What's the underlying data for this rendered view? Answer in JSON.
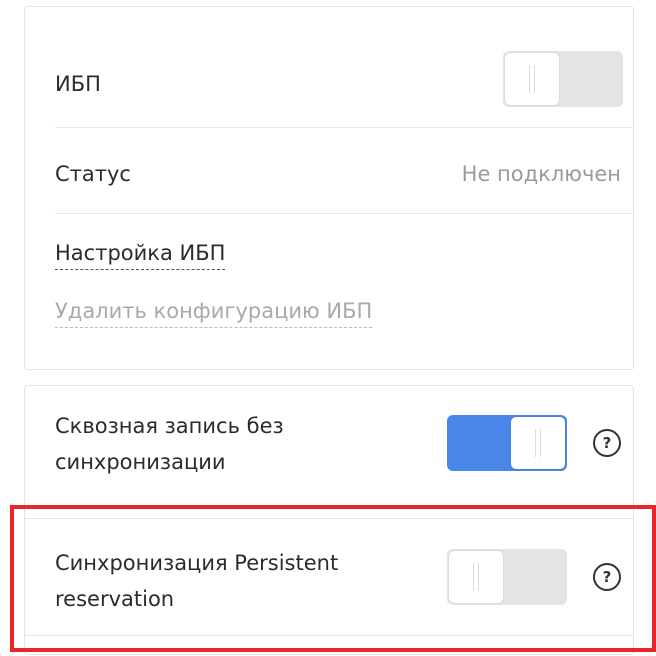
{
  "ups": {
    "title": "ИБП",
    "toggle_state": "off",
    "status_label": "Статус",
    "status_value": "Не подключен",
    "settings_link": "Настройка ИБП",
    "delete_link": "Удалить конфигурацию ИБП"
  },
  "options": {
    "writethrough_label": "Сквозная запись без синхронизации",
    "writethrough_state": "on",
    "persistent_label": "Синхронизация Persistent reservation",
    "persistent_state": "off",
    "help_glyph": "?"
  },
  "icons": {
    "help": "question-circle-icon"
  },
  "colors": {
    "accent": "#4a86e8",
    "highlight": "#e8262c",
    "muted": "#9a9a9a"
  }
}
